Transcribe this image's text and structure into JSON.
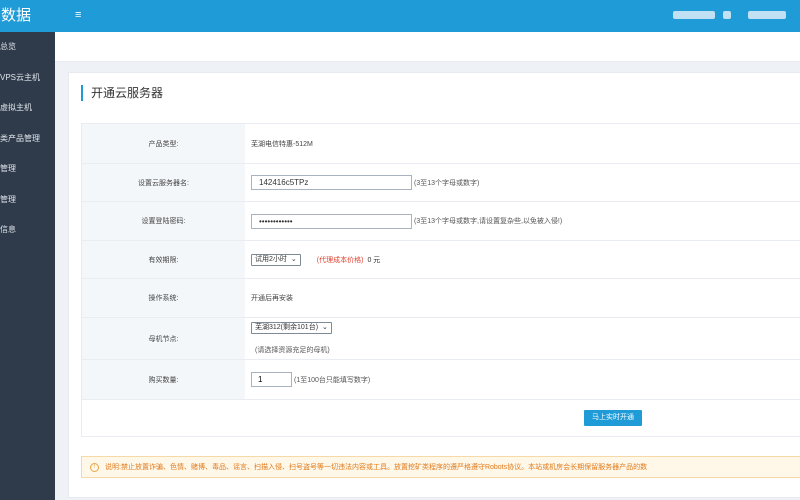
{
  "sidebar": {
    "brand": "数据",
    "items": [
      {
        "label": "总览"
      },
      {
        "label": "VPS云主机"
      },
      {
        "label": "虚拟主机"
      },
      {
        "label": "类产品管理"
      },
      {
        "label": "管理"
      },
      {
        "label": "管理"
      },
      {
        "label": "信息"
      }
    ]
  },
  "topbar": {
    "menu_icon": "≡"
  },
  "page": {
    "title": "开通云服务器"
  },
  "form": {
    "product_type_label": "产品类型:",
    "product_type_value": "芜湖电信特惠-512M",
    "server_name_label": "设置云服务器名:",
    "server_name_value": "142416c5TPz",
    "server_name_hint": "(3至13个字母或数字)",
    "password_label": "设置登陆密码:",
    "password_value": "••••••••••••",
    "password_hint": "(3至13个字母或数字,请设置复杂些,以免被入侵!)",
    "period_label": "有效期限:",
    "period_selected": "试用2小时",
    "price_note": "(代理成本价格)",
    "price_value": "0 元",
    "os_label": "操作系统:",
    "os_value": "开通后再安装",
    "node_label": "母机节点:",
    "node_selected": "芜湖312(剩余101台)",
    "node_hint": "(请选择资源充足的母机)",
    "quantity_label": "购买数量:",
    "quantity_value": "1",
    "quantity_hint": "(1至100台只能填写数字)",
    "submit_label": "马上实时开通"
  },
  "notice": {
    "icon": "!",
    "text": "说明:禁止放置诈骗、色情、赌博、毒品、谣言、扫描入侵、扫号盗号等一切违法内容或工具。放置挖矿类程序的遵严格遵守Robots协议。本站或机房会长期保留服务器产品的数"
  }
}
